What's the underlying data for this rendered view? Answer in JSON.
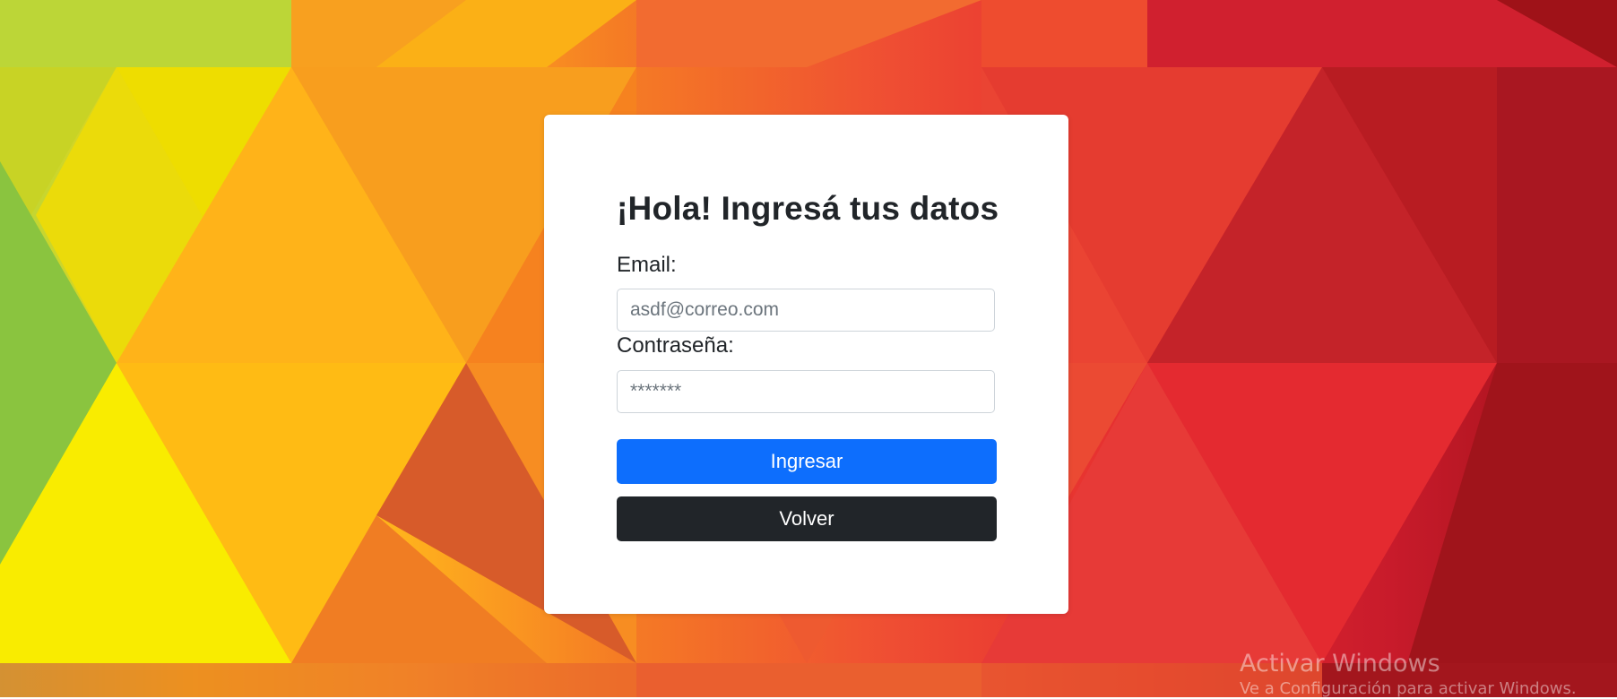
{
  "colors": {
    "primary_button": "#0d6efd",
    "dark_button": "#212529",
    "card": "#ffffff",
    "text": "#212529"
  },
  "login": {
    "title": "¡Hola! Ingresá tus datos",
    "email_label": "Email:",
    "email_placeholder": "asdf@correo.com",
    "email_value": "",
    "password_label": "Contraseña:",
    "password_placeholder": "*******",
    "password_value": "",
    "submit_label": "Ingresar",
    "back_label": "Volver"
  },
  "watermark": {
    "title": "Activar Windows",
    "subtitle": "Ve a Configuración para activar Windows."
  }
}
